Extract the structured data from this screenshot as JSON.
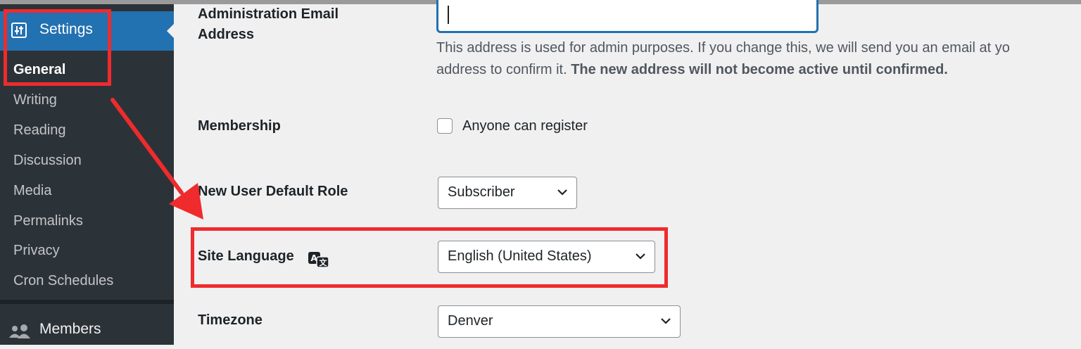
{
  "sidebar": {
    "settings": {
      "label": "Settings",
      "icon": "settings-sliders-icon"
    },
    "submenu": [
      "General",
      "Writing",
      "Reading",
      "Discussion",
      "Media",
      "Permalinks",
      "Privacy",
      "Cron Schedules"
    ],
    "current": "General",
    "members": {
      "label": "Members",
      "icon": "members-icon"
    }
  },
  "form": {
    "admin_email": {
      "label_line1": "Administration Email",
      "label_line2": "Address",
      "value": "",
      "description_line1": "This address is used for admin purposes. If you change this, we will send you an email at yo",
      "description_line2_plain": "address to confirm it. ",
      "description_line2_bold": "The new address will not become active until confirmed."
    },
    "membership": {
      "label": "Membership",
      "checkbox_label": "Anyone can register",
      "checked": false
    },
    "default_role": {
      "label": "New User Default Role",
      "value": "Subscriber"
    },
    "site_language": {
      "label": "Site Language",
      "value": "English (United States)",
      "icon": "translate-icon"
    },
    "timezone": {
      "label": "Timezone",
      "value": "Denver"
    }
  },
  "colors": {
    "sidebar_bg": "#2c3338",
    "active_menu": "#2271b1",
    "annotation_red": "#ef2b2d",
    "page_bg": "#f0f0f1"
  }
}
